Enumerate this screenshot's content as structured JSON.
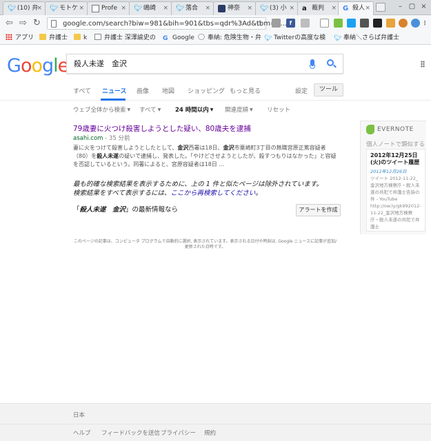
{
  "browser": {
    "tabs": [
      {
        "icon": "twitter-icon",
        "label": "(10) 弁"
      },
      {
        "icon": "twitter-icon",
        "label": "モトケ"
      },
      {
        "icon": "document-icon",
        "label": "Profe"
      },
      {
        "icon": "twitter-icon",
        "label": "嶋崎"
      },
      {
        "icon": "twitter-icon",
        "label": "落合"
      },
      {
        "icon": "site-icon",
        "label": "神奈"
      },
      {
        "icon": "twitter-icon",
        "label": "(3) 小"
      },
      {
        "icon": "amazon-icon",
        "label": "裁判"
      },
      {
        "icon": "google-icon",
        "label": "殺人"
      }
    ],
    "url": "google.com/search?biw=981&bih=901&tbs=qdr%3Ad&tbm=n...",
    "bookmarks": [
      {
        "icon": "apps-icon",
        "label": "アプリ"
      },
      {
        "icon": "folder-icon",
        "label": "弁護士"
      },
      {
        "icon": "folder-icon",
        "label": "k"
      },
      {
        "icon": "document-icon",
        "label": "弁護士 深澤諭史の"
      },
      {
        "icon": "google-icon",
        "label": "Google"
      },
      {
        "icon": "link-icon",
        "label": "奉納: 危険生物・弁"
      },
      {
        "icon": "twitter-icon",
        "label": "Twitterの高度な検"
      },
      {
        "icon": "twitter-icon",
        "label": "奉納＼さらば弁護士"
      }
    ]
  },
  "google": {
    "logo": "Google",
    "logo_colors": [
      "#4285F4",
      "#EA4335",
      "#FBBC05",
      "#4285F4",
      "#34A853",
      "#EA4335"
    ],
    "query": "殺人未遂　金沢",
    "tabs": [
      "すべて",
      "ニュース",
      "画像",
      "地図",
      "ショッピング",
      "もっと見る"
    ],
    "active_tab": "ニュース",
    "settings": "設定",
    "tools": "ツール",
    "filters": [
      "ウェブ全体から検索",
      "すべて",
      "24 時間以内",
      "関連度順",
      "リセット"
    ],
    "result": {
      "title": "79歳妻に火つけ殺害しようとした疑い、80歳夫を逮捕",
      "source": "asahi.com",
      "age": " - 35 分前",
      "snippet_parts": [
        {
          "t": "妻に火をつけて殺害しようとしたとして、",
          "b": false
        },
        {
          "t": "金沢",
          "b": true
        },
        {
          "t": "西署は18日、",
          "b": false
        },
        {
          "t": "金沢",
          "b": true
        },
        {
          "t": "市粟崎町3丁目の無職宮原正篤容疑者（80）を",
          "b": false
        },
        {
          "t": "殺人未遂",
          "b": true
        },
        {
          "t": "の疑いで逮捕し、発表した。「やけどさせようとしたが、殺すつもりはなかった」と容疑を否認しているという。同署によると、宮原容疑者は18日 ...",
          "b": false
        }
      ]
    },
    "omitted_line1": "最も的確な検索結果を表示するために、上の 1 件と似たページは除外されています。",
    "omitted_line2_pre": "検索結果をすべて表示するには、",
    "omitted_link": "ここから再検索してください",
    "omitted_line2_post": "。",
    "alert_quote_open": "「",
    "alert_query": "殺人未遂　金沢",
    "alert_suffix": "」の最新情報なら",
    "alert_button": "アラートを作成",
    "disclaimer": "このページの記事は、コンピュータ プログラムで自動的に選択, 表示されています。表示される日付や時刻は, Google ニュースに記事が追加/更新された日時です。"
  },
  "evernote": {
    "brand": "EVERNOTE",
    "label": "個人ノートで類似する",
    "note_title": "2012年12月25日(火)のツイート履歴",
    "note_date": "2012年12月26日",
    "note_body": "ツイート 2012-11-22_金沢地方検察庁・殺人未遂の共犯で弁護士告訴の件 - YouTube http://ow.ly/gk992012-11-22_金沢地方検察庁・殺人未遂の共犯で弁護士"
  },
  "footer": {
    "country": "日本",
    "links": [
      "ヘルプ",
      "フィードバックを送信",
      "プライバシー",
      "規約"
    ]
  }
}
